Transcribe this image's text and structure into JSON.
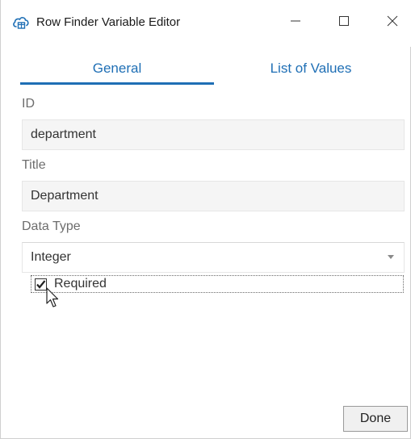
{
  "window": {
    "title": "Row Finder Variable Editor",
    "app_icon": "row-finder-cloud-icon"
  },
  "controls": {
    "minimize_icon": "minimize-icon",
    "maximize_icon": "maximize-icon",
    "close_icon": "close-icon"
  },
  "tabs": [
    {
      "label": "General",
      "active": true
    },
    {
      "label": "List of Values",
      "active": false
    }
  ],
  "form": {
    "id": {
      "label": "ID",
      "value": "department"
    },
    "title": {
      "label": "Title",
      "value": "Department"
    },
    "data_type": {
      "label": "Data Type",
      "value": "Integer"
    },
    "required": {
      "label": "Required",
      "checked": true
    }
  },
  "footer": {
    "done_label": "Done"
  },
  "colors": {
    "accent": "#1f6fb5",
    "field_bg": "#f5f5f5"
  }
}
